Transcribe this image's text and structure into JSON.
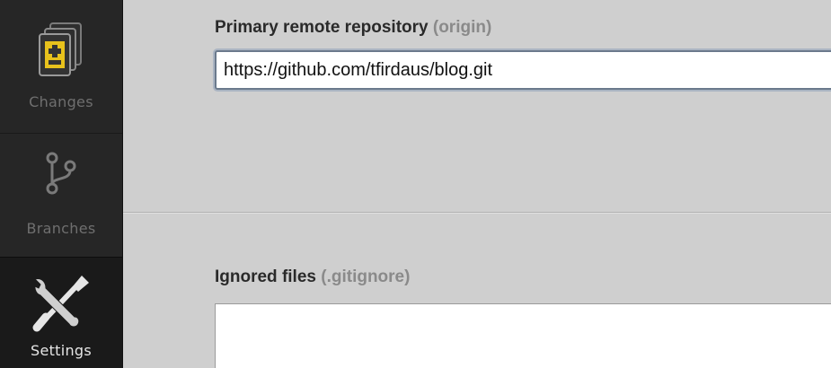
{
  "sidebar": {
    "items": [
      {
        "label": "Changes",
        "icon": "changes-icon",
        "active": false
      },
      {
        "label": "Branches",
        "icon": "branch-icon",
        "active": false
      },
      {
        "label": "Settings",
        "icon": "tools-icon",
        "active": true
      }
    ]
  },
  "settings": {
    "remote": {
      "label": "Primary remote repository",
      "hint": "(origin)",
      "value": "https://github.com/tfirdaus/blog.git"
    },
    "ignore": {
      "label": "Ignored files",
      "hint": "(.gitignore)",
      "value": ""
    }
  },
  "colors": {
    "sidebar_bg": "#262626",
    "sidebar_active_bg": "#1a1a1a",
    "main_bg": "#cfcfcf",
    "changes_icon_accent": "#e8c21c",
    "input_focus_border": "#6b7a8c"
  }
}
